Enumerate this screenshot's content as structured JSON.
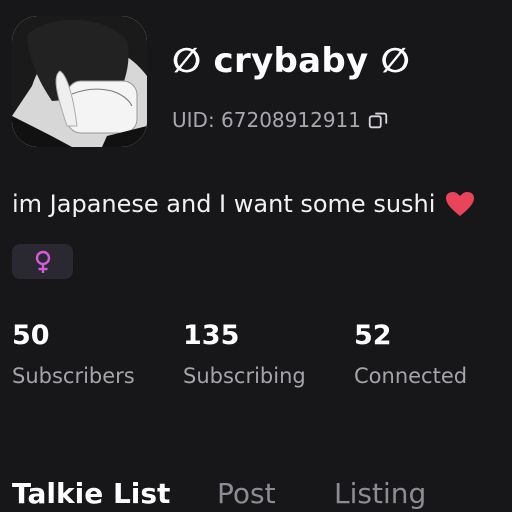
{
  "profile": {
    "display_name": "∅ crybaby ∅",
    "uid_text": "UID: 67208912911",
    "bio": "im Japanese and I want some sushi"
  },
  "stats": [
    {
      "value": "50",
      "label": "Subscribers"
    },
    {
      "value": "135",
      "label": "Subscribing"
    },
    {
      "value": "52",
      "label": "Connected"
    }
  ],
  "tabs": [
    {
      "label": "Talkie List"
    },
    {
      "label": "Post"
    },
    {
      "label": "Listing"
    }
  ],
  "icons": {
    "copy": "copy-icon",
    "heart": "heart-icon",
    "gender": "female-icon"
  },
  "colors": {
    "background": "#171619",
    "secondary_text": "#a5a4a9",
    "female_accent": "#d35bd9",
    "heart": "#e8455a"
  }
}
